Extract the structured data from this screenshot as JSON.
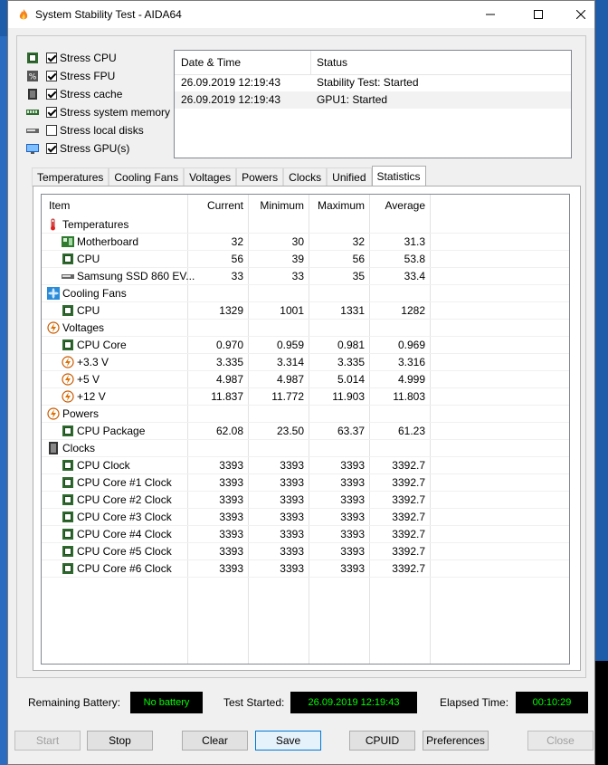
{
  "window": {
    "title": "System Stability Test - AIDA64"
  },
  "stress_options": [
    {
      "label": "Stress CPU",
      "checked": true,
      "icon": "cpu-icon"
    },
    {
      "label": "Stress FPU",
      "checked": true,
      "icon": "fpu-icon"
    },
    {
      "label": "Stress cache",
      "checked": true,
      "icon": "cache-icon"
    },
    {
      "label": "Stress system memory",
      "checked": true,
      "icon": "memory-icon"
    },
    {
      "label": "Stress local disks",
      "checked": false,
      "icon": "disk-icon"
    },
    {
      "label": "Stress GPU(s)",
      "checked": true,
      "icon": "gpu-icon"
    }
  ],
  "log": {
    "headers": [
      "Date & Time",
      "Status"
    ],
    "rows": [
      {
        "datetime": "26.09.2019 12:19:43",
        "status": "Stability Test: Started"
      },
      {
        "datetime": "26.09.2019 12:19:43",
        "status": "GPU1: Started"
      }
    ]
  },
  "tabs": [
    "Temperatures",
    "Cooling Fans",
    "Voltages",
    "Powers",
    "Clocks",
    "Unified",
    "Statistics"
  ],
  "active_tab": "Statistics",
  "stats": {
    "headers": {
      "item": "Item",
      "current": "Current",
      "minimum": "Minimum",
      "maximum": "Maximum",
      "average": "Average"
    },
    "rows": [
      {
        "type": "group",
        "label": "Temperatures",
        "icon": "thermometer-icon"
      },
      {
        "type": "item",
        "label": "Motherboard",
        "icon": "motherboard-icon",
        "current": "32",
        "minimum": "30",
        "maximum": "32",
        "average": "31.3"
      },
      {
        "type": "item",
        "label": "CPU",
        "icon": "cpu-chip-icon",
        "current": "56",
        "minimum": "39",
        "maximum": "56",
        "average": "53.8"
      },
      {
        "type": "item",
        "label": "Samsung SSD 860 EV...",
        "icon": "ssd-icon",
        "current": "33",
        "minimum": "33",
        "maximum": "35",
        "average": "33.4"
      },
      {
        "type": "group",
        "label": "Cooling Fans",
        "icon": "fan-icon"
      },
      {
        "type": "item",
        "label": "CPU",
        "icon": "cpu-chip-icon",
        "current": "1329",
        "minimum": "1001",
        "maximum": "1331",
        "average": "1282"
      },
      {
        "type": "group",
        "label": "Voltages",
        "icon": "voltage-icon"
      },
      {
        "type": "item",
        "label": "CPU Core",
        "icon": "cpu-chip-icon",
        "current": "0.970",
        "minimum": "0.959",
        "maximum": "0.981",
        "average": "0.969"
      },
      {
        "type": "item",
        "label": "+3.3 V",
        "icon": "voltage-icon",
        "current": "3.335",
        "minimum": "3.314",
        "maximum": "3.335",
        "average": "3.316"
      },
      {
        "type": "item",
        "label": "+5 V",
        "icon": "voltage-icon",
        "current": "4.987",
        "minimum": "4.987",
        "maximum": "5.014",
        "average": "4.999"
      },
      {
        "type": "item",
        "label": "+12 V",
        "icon": "voltage-icon",
        "current": "11.837",
        "minimum": "11.772",
        "maximum": "11.903",
        "average": "11.803"
      },
      {
        "type": "group",
        "label": "Powers",
        "icon": "voltage-icon"
      },
      {
        "type": "item",
        "label": "CPU Package",
        "icon": "cpu-chip-icon",
        "current": "62.08",
        "minimum": "23.50",
        "maximum": "63.37",
        "average": "61.23"
      },
      {
        "type": "group",
        "label": "Clocks",
        "icon": "clock-chip-icon"
      },
      {
        "type": "item",
        "label": "CPU Clock",
        "icon": "cpu-chip-icon",
        "current": "3393",
        "minimum": "3393",
        "maximum": "3393",
        "average": "3392.7"
      },
      {
        "type": "item",
        "label": "CPU Core #1 Clock",
        "icon": "cpu-chip-icon",
        "current": "3393",
        "minimum": "3393",
        "maximum": "3393",
        "average": "3392.7"
      },
      {
        "type": "item",
        "label": "CPU Core #2 Clock",
        "icon": "cpu-chip-icon",
        "current": "3393",
        "minimum": "3393",
        "maximum": "3393",
        "average": "3392.7"
      },
      {
        "type": "item",
        "label": "CPU Core #3 Clock",
        "icon": "cpu-chip-icon",
        "current": "3393",
        "minimum": "3393",
        "maximum": "3393",
        "average": "3392.7"
      },
      {
        "type": "item",
        "label": "CPU Core #4 Clock",
        "icon": "cpu-chip-icon",
        "current": "3393",
        "minimum": "3393",
        "maximum": "3393",
        "average": "3392.7"
      },
      {
        "type": "item",
        "label": "CPU Core #5 Clock",
        "icon": "cpu-chip-icon",
        "current": "3393",
        "minimum": "3393",
        "maximum": "3393",
        "average": "3392.7"
      },
      {
        "type": "item",
        "label": "CPU Core #6 Clock",
        "icon": "cpu-chip-icon",
        "current": "3393",
        "minimum": "3393",
        "maximum": "3393",
        "average": "3392.7"
      }
    ]
  },
  "status": {
    "battery_label": "Remaining Battery:",
    "battery_value": "No battery",
    "started_label": "Test Started:",
    "started_value": "26.09.2019 12:19:43",
    "elapsed_label": "Elapsed Time:",
    "elapsed_value": "00:10:29",
    "value_color": "#00ff00"
  },
  "buttons": {
    "start": "Start",
    "stop": "Stop",
    "clear": "Clear",
    "save": "Save",
    "cpuid": "CPUID",
    "preferences": "Preferences",
    "close": "Close"
  }
}
